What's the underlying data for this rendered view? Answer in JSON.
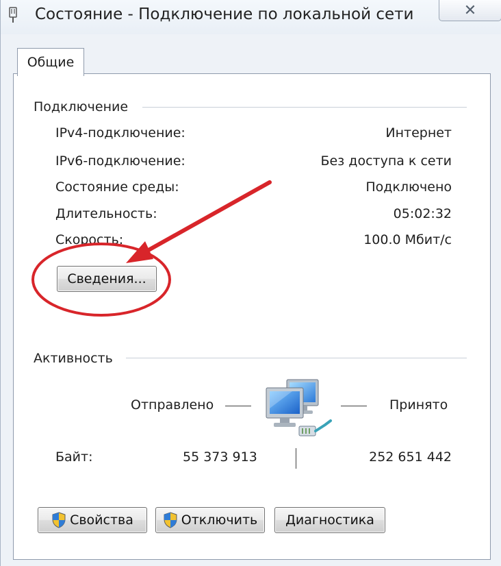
{
  "window": {
    "title": "Состояние - Подключение по локальной сети",
    "close_glyph": "✕"
  },
  "tabs": [
    {
      "label": "Общие",
      "selected": true
    }
  ],
  "connection": {
    "header": "Подключение",
    "rows": [
      {
        "label": "IPv4-подключение:",
        "value": "Интернет"
      },
      {
        "label": "IPv6-подключение:",
        "value": "Без доступа к сети"
      },
      {
        "label": "Состояние среды:",
        "value": "Подключено"
      },
      {
        "label": "Длительность:",
        "value": "05:02:32"
      },
      {
        "label": "Скорость:",
        "value": "100.0 Мбит/с"
      }
    ],
    "details_button": "Сведения..."
  },
  "activity": {
    "header": "Активность",
    "sent_label": "Отправлено",
    "received_label": "Принято",
    "bytes_label": "Байт:",
    "bytes_sent": "55 373 913",
    "bytes_received": "252 651 442",
    "icon": "network-computers-icon"
  },
  "buttons": {
    "properties": "Свойства",
    "disable": "Отключить",
    "diagnose": "Диагностика"
  },
  "annotation": {
    "color": "#d8252a",
    "icons": [
      "red-arrow",
      "red-ellipse"
    ]
  }
}
